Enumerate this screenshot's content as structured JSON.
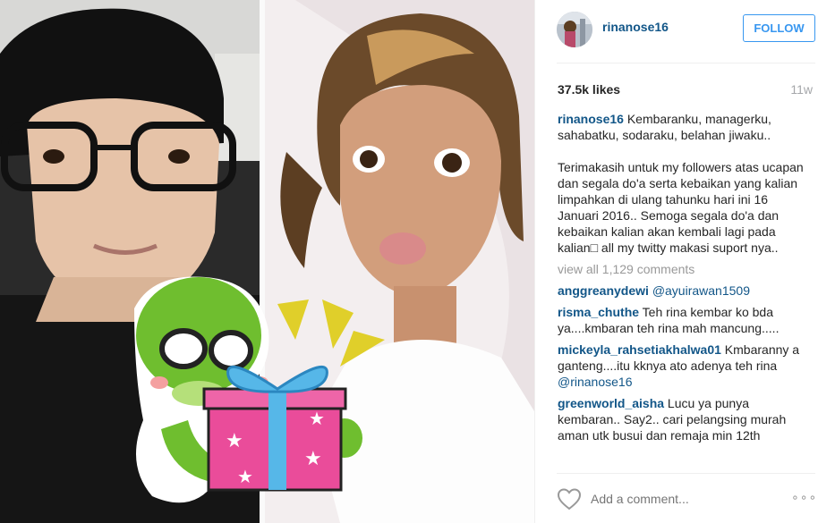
{
  "post": {
    "username": "rinanose16",
    "follow_label": "FOLLOW",
    "likes": "37.5k likes",
    "time_ago": "11w",
    "caption": {
      "username": "rinanose16",
      "text": " Kembaranku, managerku, sahabatku, sodaraku, belahan jiwaku..\n\nTerimakasih untuk my followers atas ucapan dan segala do'a serta kebaikan yang kalian limpahkan di ulang tahunku hari ini 16 Januari 2016.. Semoga segala do'a dan kebaikan kalian akan kembali lagi pada kalian□ all my twitty makasi suport nya.."
    },
    "view_all_label": "view all 1,129 comments",
    "comments": [
      {
        "username": "anggreanydewi",
        "text": " ",
        "mention": "@ayuirawan1509"
      },
      {
        "username": "risma_chuthe",
        "text": " Teh rina kembar ko bda ya....kmbaran teh rina mah mancung.....",
        "mention": ""
      },
      {
        "username": "mickeyla_rahsetiakhalwa01",
        "text": " Kmbaranny a ganteng....itu kknya ato adenya teh rina ",
        "mention": "@rinanose16"
      },
      {
        "username": "greenworld_aisha",
        "text": " Lucu ya punya kembaran.. Say2.. cari pelangsing murah aman utk busui dan remaja min 12th",
        "mention": ""
      }
    ],
    "add_comment_placeholder": "Add a comment...",
    "more_label": "∘∘∘"
  },
  "icons": {
    "heart": "heart-outline-icon",
    "more": "more-options-icon"
  },
  "colors": {
    "username": "#125688",
    "follow_border": "#3897f0",
    "muted": "#999999"
  }
}
